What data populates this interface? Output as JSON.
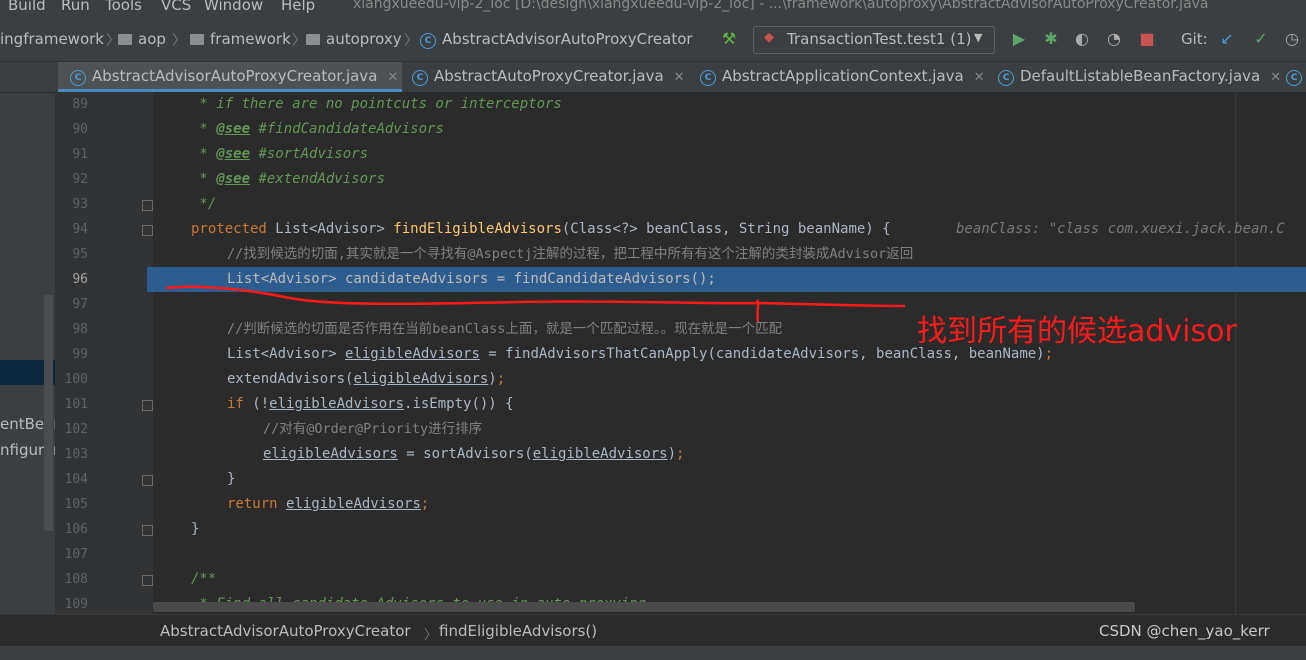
{
  "menu": [
    "Build",
    "Run",
    "Tools",
    "VCS",
    "Window",
    "Help"
  ],
  "window_title": "xiangxueedu-vip-2_ioc [D:\\design\\xiangxueedu-vip-2_ioc] - ...\\framework\\autoproxy\\AbstractAdvisorAutoProxyCreator.java",
  "breadcrumbs": [
    "ingframework",
    "aop",
    "framework",
    "autoproxy",
    "AbstractAdvisorAutoProxyCreator"
  ],
  "run_config": "TransactionTest.test1 (1)",
  "git_label": "Git:",
  "tabs": [
    "AbstractAdvisorAutoProxyCreator.java",
    "AbstractAutoProxyCreator.java",
    "AbstractApplicationContext.java",
    "DefaultListableBeanFactory.java"
  ],
  "left_panel": [
    "entBear",
    "nfigurerI"
  ],
  "code": {
    "l89": {
      "num": "89",
      "t": " * if there are no pointcuts or interceptors"
    },
    "l90": {
      "num": "90",
      "tag": "@see",
      "t": " #findCandidateAdvisors"
    },
    "l91": {
      "num": "91",
      "tag": "@see",
      "t": " #sortAdvisors"
    },
    "l92": {
      "num": "92",
      "tag": "@see",
      "t": " #extendAdvisors"
    },
    "l93": {
      "num": "93",
      "t": " */"
    },
    "l94": {
      "num": "94",
      "kw": "protected",
      "a": " List<Advisor> ",
      "fn": "findEligibleAdvisors",
      "b": "(Class<?> beanClass, String beanName) {",
      "hint": "beanClass: \"class com.xuexi.jack.bean.C"
    },
    "l95": {
      "num": "95",
      "t": "//找到候选的切面,其实就是一个寻找有@Aspectj注解的过程，把工程中所有有这个注解的类封装成Advisor返回"
    },
    "l96": {
      "num": "96",
      "t": "List<Advisor> candidateAdvisors = findCandidateAdvisors();"
    },
    "l97": {
      "num": "97"
    },
    "l98": {
      "num": "98",
      "t": "//判断候选的切面是否作用在当前beanClass上面，就是一个匹配过程。。现在就是一个匹配"
    },
    "l99": {
      "num": "99",
      "a": "List<Advisor> ",
      "v": "eligibleAdvisors",
      "b": " = findAdvisorsThatCanApply(candidateAdvisors, beanClass, beanName)",
      "c": ";"
    },
    "l100": {
      "num": "100",
      "a": "extendAdvisors(",
      "v": "eligibleAdvisors",
      "b": ")",
      "c": ";"
    },
    "l101": {
      "num": "101",
      "kw": "if",
      "a": " (!",
      "v": "eligibleAdvisors",
      "b": ".isEmpty()) {"
    },
    "l102": {
      "num": "102",
      "t": "//对有@Order@Priority进行排序"
    },
    "l103": {
      "num": "103",
      "v": "eligibleAdvisors",
      "a": " = sortAdvisors(",
      "v2": "eligibleAdvisors",
      "b": ")",
      "c": ";"
    },
    "l104": {
      "num": "104",
      "t": "}"
    },
    "l105": {
      "num": "105",
      "kw": "return",
      "v": "eligibleAdvisors",
      "c": ";"
    },
    "l106": {
      "num": "106",
      "t": "}"
    },
    "l107": {
      "num": "107"
    },
    "l108": {
      "num": "108",
      "t": "/**"
    },
    "l109": {
      "num": "109",
      "t": " * Find all candidate Advisors to use in auto-proxying."
    }
  },
  "annotation": "找到所有的候选advisor",
  "status_breadcrumb": [
    "AbstractAdvisorAutoProxyCreator",
    "findEligibleAdvisors()"
  ],
  "watermark": "CSDN @chen_yao_kerr"
}
